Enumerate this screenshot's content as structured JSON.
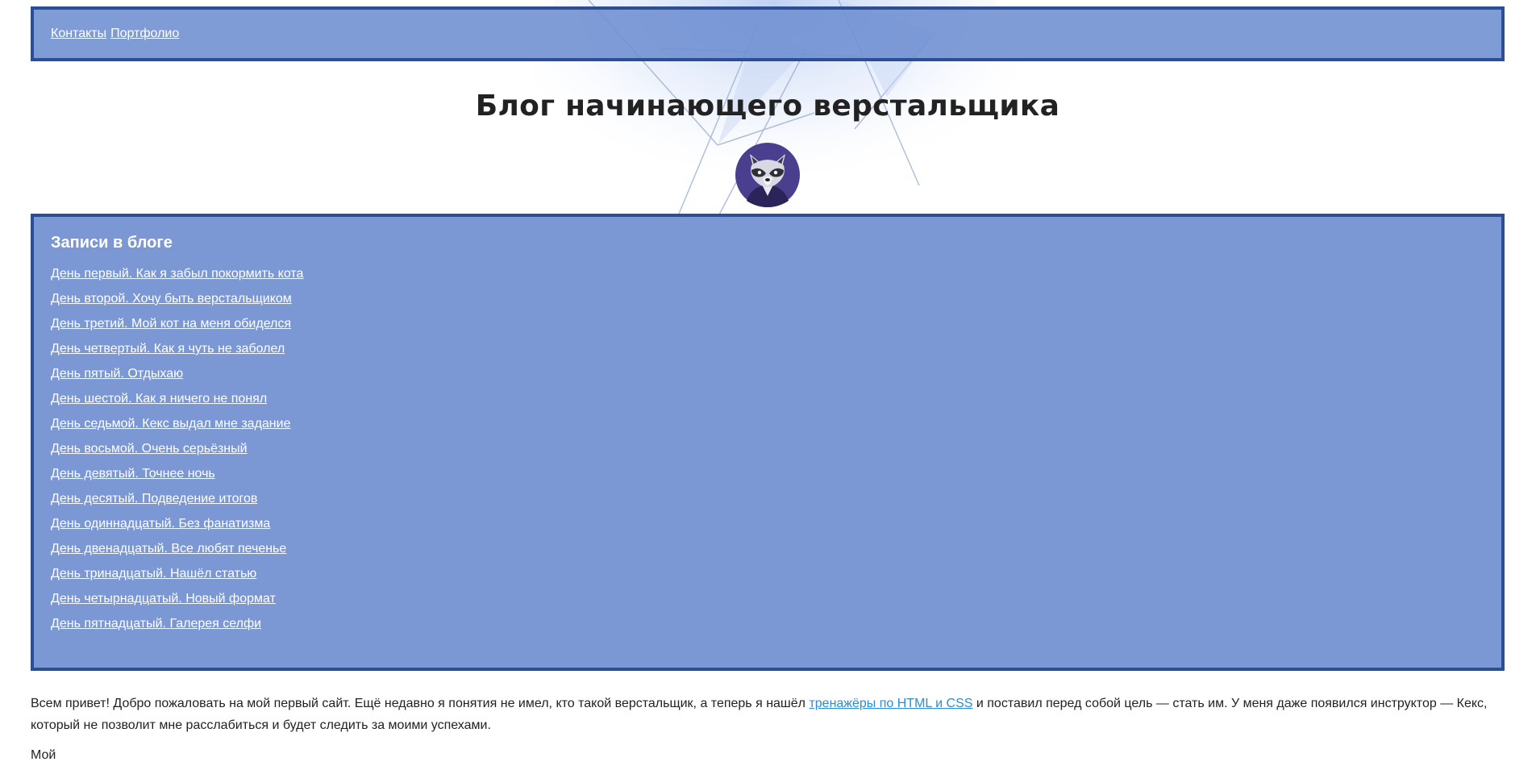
{
  "nav": {
    "links": [
      {
        "label": "Контакты"
      },
      {
        "label": "Портфолио"
      }
    ]
  },
  "page": {
    "title": "Блог начинающего верстальщика"
  },
  "blog": {
    "heading": "Записи в блоге",
    "posts": [
      "День первый. Как я забыл покормить кота",
      "День второй. Хочу быть верстальщиком",
      "День третий. Мой кот на меня обиделся",
      "День четвертый. Как я чуть не заболел",
      "День пятый. Отдыхаю",
      "День шестой. Как я ничего не понял",
      "День седьмой. Кекс выдал мне задание",
      "День восьмой. Очень серьёзный",
      "День девятый. Точнее ночь",
      "День десятый. Подведение итогов",
      "День одиннадцатый. Без фанатизма",
      "День двенадцатый. Все любят печенье",
      "День тринадцатый. Нашёл статью",
      "День четырнадцатый. Новый формат",
      "День пятнадцатый. Галерея селфи"
    ]
  },
  "intro": {
    "text_before_link": "Всем привет! Добро пожаловать на мой первый сайт. Ещё недавно я понятия не имел, кто такой верстальщик, а теперь я нашёл ",
    "link_text": "тренажёры по HTML и CSS",
    "text_after_link": " и поставил перед собой цель — стать им. У меня даже появился инструктор — Кекс, который не позволит мне расслабиться и будет следить за моими успехами.",
    "next_paragraph_partial": "Мой"
  },
  "colors": {
    "nav_bg": "#7b98d5",
    "border": "#2c4e94",
    "link_accent": "#2a8ecf",
    "avatar_bg": "#4a3f8f"
  },
  "icons": {
    "avatar": "raccoon-avatar-icon"
  }
}
